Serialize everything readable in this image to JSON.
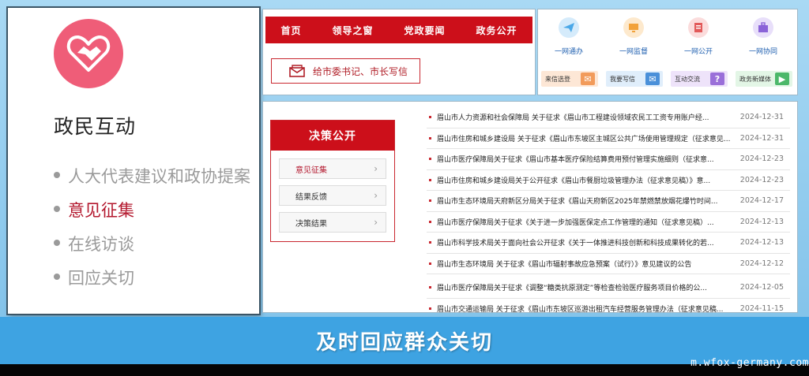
{
  "left_panel": {
    "title": "政民互动",
    "items": [
      {
        "label": "人大代表建议和政协提案",
        "active": false
      },
      {
        "label": "意见征集",
        "active": true
      },
      {
        "label": "在线访谈",
        "active": false
      },
      {
        "label": "回应关切",
        "active": false
      }
    ]
  },
  "nav": {
    "items": [
      "首页",
      "领导之窗",
      "党政要闻",
      "政务公开"
    ],
    "letter_button": "给市委书记、市长写信"
  },
  "quick_links": [
    {
      "label": "一网通办",
      "icon": "paper-plane-icon",
      "color": "#4aa8e8"
    },
    {
      "label": "一网监督",
      "icon": "monitor-icon",
      "color": "#f2a23a"
    },
    {
      "label": "一网公开",
      "icon": "document-icon",
      "color": "#e25a5a"
    },
    {
      "label": "一网协同",
      "icon": "briefcase-icon",
      "color": "#8a63d8"
    }
  ],
  "tiles": [
    {
      "label": "来信选登",
      "icon": "letters-icon",
      "bg": "#fde7d6",
      "accent": "#f29b5b"
    },
    {
      "label": "我要写信",
      "icon": "envelope-icon",
      "bg": "#e0eefb",
      "accent": "#4a90d9"
    },
    {
      "label": "互动交流",
      "icon": "question-icon",
      "bg": "#eee3fa",
      "accent": "#9a6fd9"
    },
    {
      "label": "政务新媒体",
      "icon": "play-icon",
      "bg": "#e3f6e6",
      "accent": "#4cb86a"
    }
  ],
  "side_panel": {
    "title": "决策公开",
    "items": [
      {
        "label": "意见征集",
        "active": true
      },
      {
        "label": "结果反馈",
        "active": false
      },
      {
        "label": "决策结果",
        "active": false
      }
    ]
  },
  "news": [
    {
      "title": "眉山市人力资源和社会保障局 关于征求《眉山市工程建设领域农民工工资专用账户经...",
      "date": "2024-12-31"
    },
    {
      "title": "眉山市住房和城乡建设局 关于征求《眉山市东坡区主城区公共广场使用管理规定（征求意见...",
      "date": "2024-12-31"
    },
    {
      "title": "眉山市医疗保障局关于征求《眉山市基本医疗保险结算费用预付管理实施细则（征求意...",
      "date": "2024-12-23"
    },
    {
      "title": "眉山市住房和城乡建设局关于公开征求《眉山市餐厨垃圾管理办法（征求意见稿）》意...",
      "date": "2024-12-23"
    },
    {
      "title": "眉山市生态环境局天府新区分局关于征求《眉山天府新区2025年禁燃禁放烟花爆竹时间...",
      "date": "2024-12-17"
    },
    {
      "title": "眉山市医疗保障局关于征求《关于进一步加强医保定点工作管理的通知（征求意见稿）...",
      "date": "2024-12-13"
    },
    {
      "title": "眉山市科学技术局关于面向社会公开征求《关于一体推进科技创新和科技成果转化的若...",
      "date": "2024-12-13"
    },
    {
      "title": "眉山市生态环境局 关于征求《眉山市辐射事故应急预案（试行）》意见建议的公告",
      "date": "2024-12-12"
    },
    {
      "title": "眉山市医疗保障局关于征求《调整“糖类抗原测定”等检查检验医疗服务项目价格的公...",
      "date": "2024-12-05"
    },
    {
      "title": "眉山市交通运输局 关于征求《眉山市东坡区巡游出租汽车经营服务管理办法（征求意见稿...",
      "date": "2024-11-15"
    }
  ],
  "banner": "及时回应群众关切",
  "watermark": "m.wfox-germany.com",
  "colors": {
    "accent_red": "#cc0f1a",
    "banner_blue": "#3ea3e2",
    "logo_pink": "#ef5d78"
  }
}
